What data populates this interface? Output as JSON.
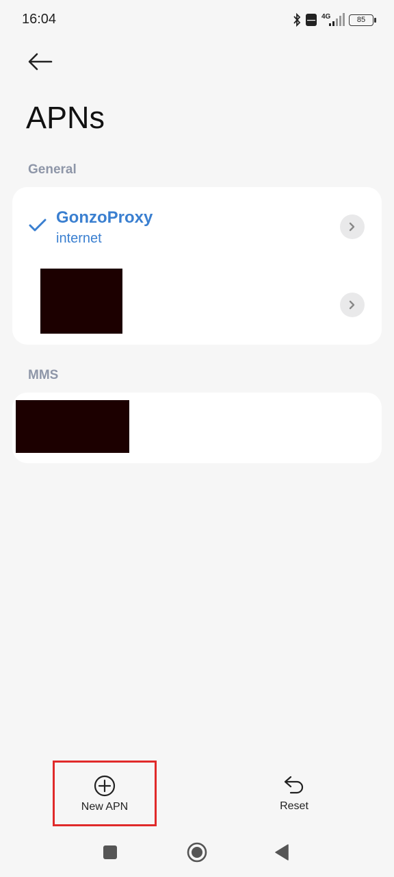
{
  "status_bar": {
    "time": "16:04",
    "network": "4G",
    "battery": "85",
    "icons": [
      "bluetooth-icon",
      "volte-icon",
      "signal-icon",
      "battery-icon"
    ]
  },
  "header": {
    "title": "APNs",
    "back_icon": "arrow-left-icon"
  },
  "sections": {
    "general": {
      "label": "General",
      "items": [
        {
          "name": "GonzoProxy",
          "type": "internet",
          "selected": true
        },
        {
          "name": "",
          "type": "",
          "selected": false,
          "redacted": true
        }
      ]
    },
    "mms": {
      "label": "MMS",
      "items": [
        {
          "name": "",
          "type": "",
          "redacted": true
        }
      ]
    }
  },
  "bottom_bar": {
    "new_apn_label": "New APN",
    "reset_label": "Reset"
  },
  "colors": {
    "accent": "#3a7fd0",
    "highlight_border": "#e02a2a",
    "section_label": "#8e96a8",
    "background": "#f6f6f6"
  }
}
